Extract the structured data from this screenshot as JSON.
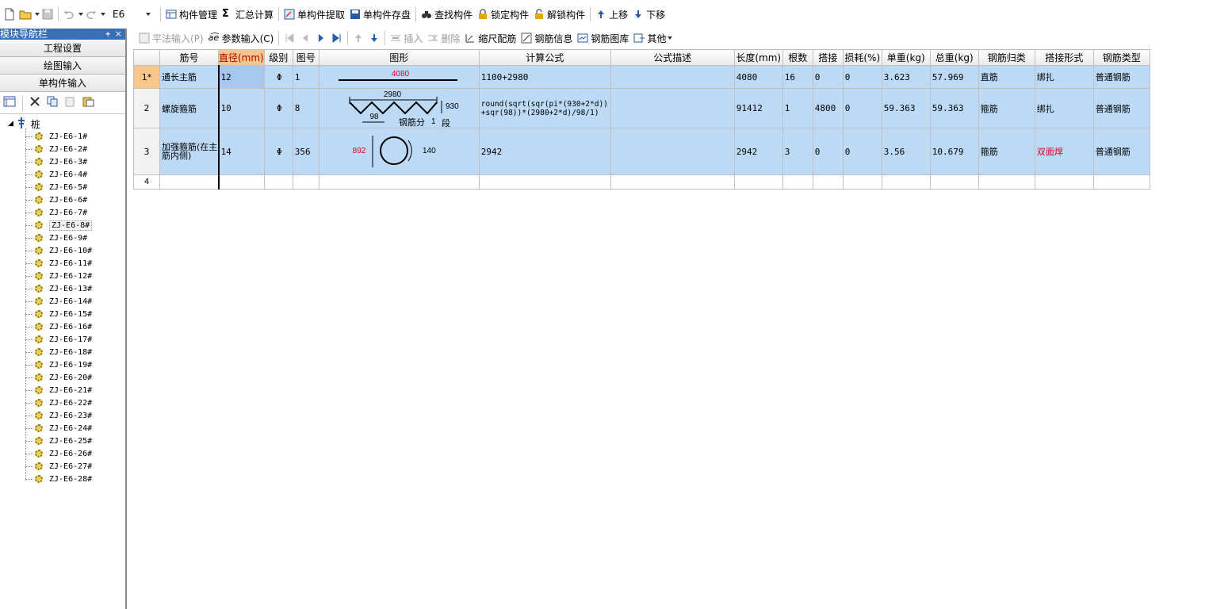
{
  "toolbar": {
    "floor_combo_value": "E6",
    "buttons": [
      {
        "label": "构件管理"
      },
      {
        "label": "汇总计算"
      },
      {
        "label": "单构件提取"
      },
      {
        "label": "单构件存盘"
      },
      {
        "label": "查找构件"
      },
      {
        "label": "锁定构件"
      },
      {
        "label": "解锁构件"
      },
      {
        "label": "上移"
      },
      {
        "label": "下移"
      }
    ]
  },
  "nav": {
    "title": "模块导航栏",
    "pin": "ᚐ",
    "close": "×",
    "sections": [
      "工程设置",
      "绘图输入",
      "单构件输入"
    ],
    "tree_root": "桩",
    "tree_items": [
      "ZJ-E6-1#",
      "ZJ-E6-2#",
      "ZJ-E6-3#",
      "ZJ-E6-4#",
      "ZJ-E6-5#",
      "ZJ-E6-6#",
      "ZJ-E6-7#",
      "ZJ-E6-8#",
      "ZJ-E6-9#",
      "ZJ-E6-10#",
      "ZJ-E6-11#",
      "ZJ-E6-12#",
      "ZJ-E6-13#",
      "ZJ-E6-14#",
      "ZJ-E6-15#",
      "ZJ-E6-16#",
      "ZJ-E6-17#",
      "ZJ-E6-18#",
      "ZJ-E6-19#",
      "ZJ-E6-20#",
      "ZJ-E6-21#",
      "ZJ-E6-22#",
      "ZJ-E6-23#",
      "ZJ-E6-24#",
      "ZJ-E6-25#",
      "ZJ-E6-26#",
      "ZJ-E6-27#",
      "ZJ-E6-28#"
    ],
    "selected_item": "ZJ-E6-8#"
  },
  "subtoolbar": {
    "flat_input": "平法输入(P)",
    "param_input": "参数输入(C)",
    "insert": "插入",
    "delete": "删除",
    "scale_config": "缩尺配筋",
    "rebar_info": "钢筋信息",
    "rebar_library": "钢筋图库",
    "other": "其他"
  },
  "grid": {
    "headers": [
      "筋号",
      "直径(mm)",
      "级别",
      "图号",
      "图形",
      "计算公式",
      "公式描述",
      "长度(mm)",
      "根数",
      "搭接",
      "损耗(%)",
      "单重(kg)",
      "总重(kg)",
      "钢筋归类",
      "搭接形式",
      "钢筋类型"
    ],
    "rows": [
      {
        "num": "1*",
        "name": "通长主筋",
        "diameter": "12",
        "grade": "Φ",
        "fig_no": "1",
        "formula": "1100+2980",
        "desc": "",
        "length": "4080",
        "count": "16",
        "lap": "0",
        "loss": "0",
        "unit_weight": "3.623",
        "total_weight": "57.969",
        "category": "直筋",
        "lap_type": "绑扎",
        "rebar_type": "普通钢筋",
        "shape": {
          "dim": "4080"
        }
      },
      {
        "num": "2",
        "name": "螺旋箍筋",
        "diameter": "10",
        "grade": "Φ",
        "fig_no": "8",
        "formula": "round(sqrt(sqr(pi*(930+2*d))+sqr(98))*(2980+2*d)/98/1)",
        "desc": "",
        "length": "91412",
        "count": "1",
        "lap": "4800",
        "loss": "0",
        "unit_weight": "59.363",
        "total_weight": "59.363",
        "category": "箍筋",
        "lap_type": "绑扎",
        "rebar_type": "普通钢筋",
        "shape": {
          "top": "2980",
          "right": "930",
          "pitch": "98",
          "text1": "钢筋分",
          "text2": "1",
          "text3": "段"
        }
      },
      {
        "num": "3",
        "name": "加强箍筋(在主筋内侧)",
        "diameter": "14",
        "grade": "Φ",
        "fig_no": "356",
        "formula": "2942",
        "desc": "",
        "length": "2942",
        "count": "3",
        "lap": "0",
        "loss": "0",
        "unit_weight": "3.56",
        "total_weight": "10.679",
        "category": "箍筋",
        "lap_type": "双面焊",
        "rebar_type": "普通钢筋",
        "shape": {
          "left": "892",
          "right": "140"
        }
      },
      {
        "num": "4"
      }
    ]
  },
  "colors": {
    "row_fill": "#bcdaf6",
    "active_header": "#f6c68a",
    "red_text": "#e0001a",
    "nav_title": "#3a6fb6"
  }
}
